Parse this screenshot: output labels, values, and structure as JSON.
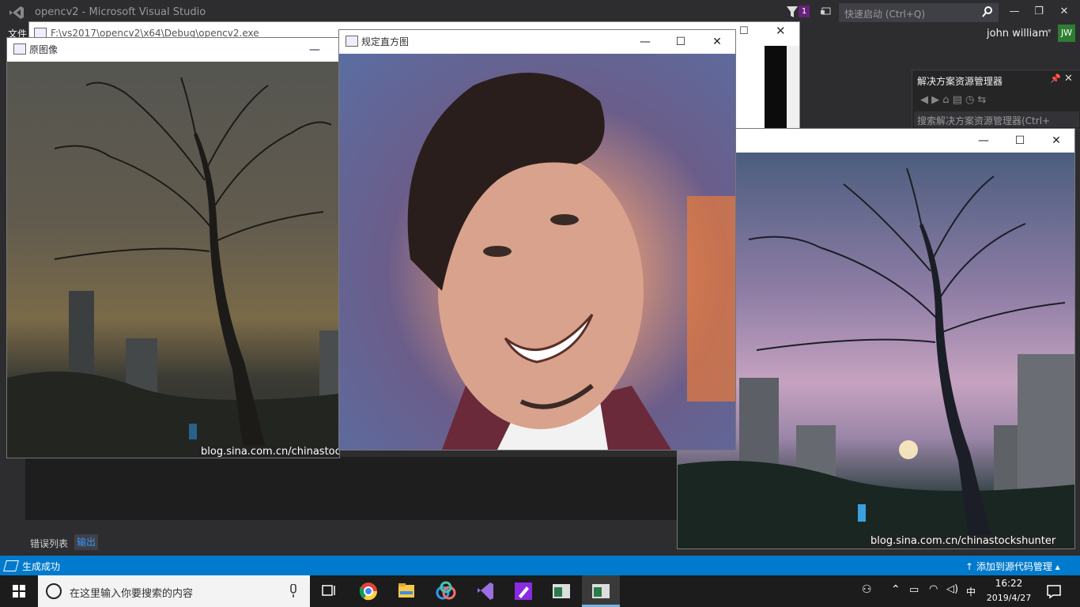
{
  "vs": {
    "title": "opencv2 - Microsoft Visual Studio",
    "notifications_count": "1",
    "quick_launch_placeholder": "快速启动 (Ctrl+Q)",
    "user_name": "john william",
    "user_initials": "JW",
    "menu_file": "文件",
    "minimize": "—",
    "maximize": "❐",
    "close": "✕"
  },
  "console": {
    "title": "F:\\vs2017\\opencv2\\x64\\Debug\\opencv2.exe"
  },
  "solution_explorer": {
    "title": "解决方案资源管理器",
    "search_placeholder": "搜索解决方案资源管理器(Ctrl+"
  },
  "output_tabs": {
    "errors": "错误列表",
    "output": "输出"
  },
  "status": {
    "message": "生成成功",
    "source_control": "↑  添加到源代码管理 ▴"
  },
  "windows": {
    "original": {
      "title": "原图像",
      "watermark": "blog.sina.com.cn/chinastockshunter"
    },
    "specified": {
      "title": "规定直方图"
    },
    "result": {
      "title": "",
      "watermark": "blog.sina.com.cn/chinastockshunter"
    },
    "btn_min": "—",
    "btn_max": "☐",
    "btn_close": "✕"
  },
  "taskbar": {
    "search_placeholder": "在这里输入你要搜索的内容",
    "time": "16:22",
    "date": "2019/4/27",
    "ime": "中"
  }
}
